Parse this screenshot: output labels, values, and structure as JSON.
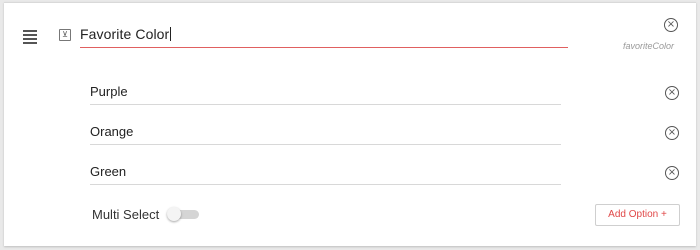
{
  "question": {
    "title": "Favorite Color",
    "field_key": "favoriteColor",
    "type_icon_glyph": "⊻"
  },
  "options": [
    {
      "label": "Purple"
    },
    {
      "label": "Orange"
    },
    {
      "label": "Green"
    }
  ],
  "multi_select": {
    "label": "Multi Select",
    "enabled": false
  },
  "add_option_label": "Add Option +",
  "icons": {
    "drag": "drag-handle-icon",
    "type": "dropdown-type-icon",
    "close": "close-circle-icon"
  },
  "colors": {
    "accent": "#e04848",
    "underline_active": "#e06060"
  }
}
